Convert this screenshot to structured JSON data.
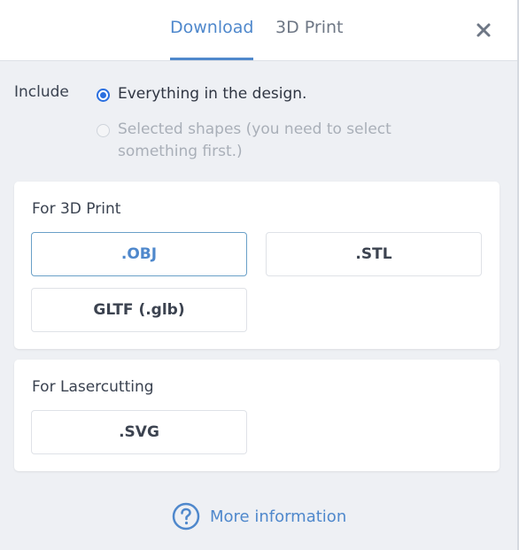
{
  "tabs": [
    {
      "label": "Download",
      "active": true
    },
    {
      "label": "3D Print",
      "active": false
    }
  ],
  "include": {
    "label": "Include",
    "options": [
      {
        "label": "Everything in the design.",
        "selected": true,
        "enabled": true
      },
      {
        "label": "Selected shapes (you need to select something first.)",
        "selected": false,
        "enabled": false
      }
    ]
  },
  "sections": [
    {
      "title": "For 3D Print",
      "buttons": [
        {
          "label": ".OBJ",
          "selected": true
        },
        {
          "label": ".STL",
          "selected": false
        },
        {
          "label": "GLTF (.glb)",
          "selected": false
        }
      ]
    },
    {
      "title": "For Lasercutting",
      "buttons": [
        {
          "label": ".SVG",
          "selected": false
        }
      ]
    }
  ],
  "more_info": {
    "label": "More information"
  },
  "colors": {
    "accent": "#4f88cc",
    "radio_selected": "#2a6fe0",
    "background": "#eef0f4"
  },
  "icons": {
    "close": "close-icon",
    "help": "question-circle-icon"
  }
}
